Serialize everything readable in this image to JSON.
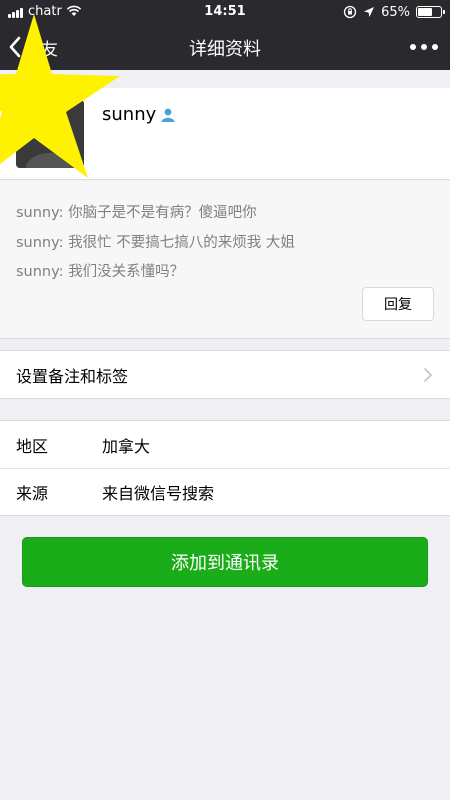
{
  "status_bar": {
    "carrier": "chatr",
    "time": "14:51",
    "battery_percent": "65%",
    "battery_level": 0.65
  },
  "nav": {
    "back_label": "朋友",
    "title": "详细资料"
  },
  "profile": {
    "nickname": "sunny"
  },
  "greetings": {
    "messages": [
      "sunny: 你脑子是不是有病？傻逼吧你",
      "sunny: 我很忙 不要搞七搞八的来烦我 大姐",
      "sunny: 我们没关系懂吗？"
    ],
    "reply_label": "回复"
  },
  "remark_row": {
    "label": "设置备注和标签"
  },
  "info": {
    "region_label": "地区",
    "region_value": "加拿大",
    "source_label": "来源",
    "source_value": "来自微信号搜索"
  },
  "add_button_label": "添加到通讯录",
  "colors": {
    "nav_bg": "#2a2a2e",
    "accent_green": "#1aad19",
    "annotation_star": "#fff200"
  },
  "icons": [
    "signal-icon",
    "wifi-icon",
    "rotation-lock-icon",
    "location-arrow-icon",
    "battery-icon",
    "back-chevron-icon",
    "more-icon",
    "person-badge-icon",
    "chevron-right-icon",
    "star-annotation"
  ]
}
